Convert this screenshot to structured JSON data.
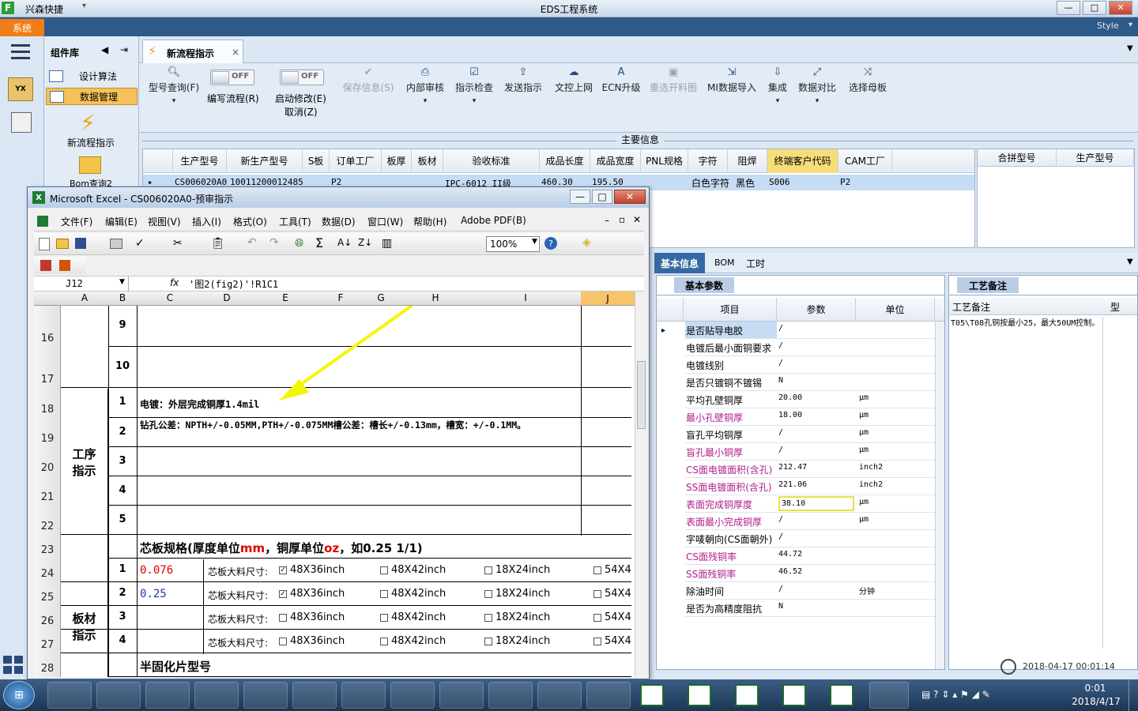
{
  "window": {
    "app_name": "兴森快捷",
    "title": "EDS工程系统",
    "style_label": "Style",
    "controls": [
      "—",
      "□",
      "✕"
    ]
  },
  "system_button": "系统",
  "component_panel": {
    "title": "组件库",
    "items": [
      "设计算法",
      "数据管理"
    ],
    "flow_label": "新流程指示",
    "bom_label": "Bom查询2"
  },
  "tab": {
    "label": "新流程指示",
    "close": "×"
  },
  "ribbon": {
    "model_query": "型号查询(F)",
    "write_flow": "编写流程(R)",
    "start_modify": "启动修改(E)",
    "cancel": "取消(Z)",
    "toggle_off": "OFF",
    "buttons": [
      "保存信息(S)",
      "内部审核",
      "指示检查",
      "发送指示",
      "文控上网",
      "ECN升级",
      "重选开料图",
      "MI数据导入",
      "集成",
      "数据对比",
      "选择母板"
    ]
  },
  "main_info": {
    "title": "主要信息",
    "headers": [
      "生产型号",
      "新生产型号",
      "S板",
      "订单工厂",
      "板厚",
      "板材",
      "验收标准",
      "成品长度",
      "成品宽度",
      "PNL规格",
      "字符",
      "阻焊",
      "终端客户代码",
      "CAM工厂"
    ],
    "row": [
      "CS006020A0",
      "10011200012485",
      "",
      "P2",
      "",
      "",
      "IPC-6012 II级",
      "460.30",
      "195.50",
      "",
      "白色字符",
      "黑色",
      "S006",
      "P2"
    ],
    "side_headers": [
      "合拼型号",
      "生产型号"
    ]
  },
  "excel": {
    "title": "Microsoft Excel - CS006020A0-预审指示",
    "menus": [
      "文件(F)",
      "编辑(E)",
      "视图(V)",
      "插入(I)",
      "格式(O)",
      "工具(T)",
      "数据(D)",
      "窗口(W)",
      "帮助(H)",
      "Adobe PDF(B)"
    ],
    "zoom": "100%",
    "name_box": "J12",
    "formula": "'图2(fig2)'!R1C1",
    "columns": [
      "A",
      "B",
      "C",
      "D",
      "E",
      "F",
      "G",
      "H",
      "I",
      "J"
    ],
    "rows": [
      "16",
      "17",
      "18",
      "19",
      "20",
      "21",
      "22",
      "23",
      "24",
      "25",
      "26",
      "27",
      "28"
    ],
    "b_values": [
      "9",
      "10",
      "1",
      "2",
      "3",
      "4",
      "5",
      "",
      "1",
      "2",
      "3",
      "4",
      ""
    ],
    "section_process": "工序\n指示",
    "section_board": "板材\n指示",
    "line_plating": "电镀：外层完成铜厚1.4mil",
    "line_drill": "钻孔公差：NPTH+/-0.05MM,PTH+/-0.075MM槽公差：槽长+/-0.13mm，槽宽：+/-0.1MM。",
    "core_spec": {
      "prefix": "芯板规格(厚度单位",
      "mm": "mm",
      "mid": "，铜厚单位",
      "oz": "oz",
      "suffix": "，如0.25 1/1)"
    },
    "core_values": [
      "0.076",
      "0.25",
      "",
      ""
    ],
    "size_label": "芯板大料尺寸:",
    "sizes": [
      "48X36inch",
      "48X42inch",
      "18X24inch",
      "54X4"
    ],
    "prepreg_label": "半固化片型号"
  },
  "right_panel": {
    "tabs": [
      "基本信息",
      "BOM",
      "工时"
    ],
    "basic_tab": "基本参数",
    "craft_tab": "工艺备注",
    "headers": [
      "项目",
      "参数",
      "单位"
    ],
    "rows": [
      {
        "name": "是否贴导电胶",
        "value": "/",
        "unit": "",
        "pink": false
      },
      {
        "name": "电镀后最小面铜要求",
        "value": "/",
        "unit": "",
        "pink": false
      },
      {
        "name": "电镀线别",
        "value": "/",
        "unit": "",
        "pink": false
      },
      {
        "name": "是否只镀铜不镀锡",
        "value": "N",
        "unit": "",
        "pink": false
      },
      {
        "name": "平均孔壁铜厚",
        "value": "20.00",
        "unit": "μm",
        "pink": false
      },
      {
        "name": "最小孔壁铜厚",
        "value": "18.00",
        "unit": "μm",
        "pink": true
      },
      {
        "name": "盲孔平均铜厚",
        "value": "/",
        "unit": "μm",
        "pink": false
      },
      {
        "name": "盲孔最小铜厚",
        "value": "/",
        "unit": "μm",
        "pink": true
      },
      {
        "name": "CS面电镀面积(含孔)",
        "value": "212.47",
        "unit": "inch2",
        "pink": true
      },
      {
        "name": "SS面电镀面积(含孔)",
        "value": "221.06",
        "unit": "inch2",
        "pink": true
      },
      {
        "name": "表面完成铜厚度",
        "value": "38.10",
        "unit": "μm",
        "pink": true
      },
      {
        "name": "表面最小完成铜厚",
        "value": "/",
        "unit": "μm",
        "pink": true
      },
      {
        "name": "字唛朝向(CS面朝外)",
        "value": "/",
        "unit": "",
        "pink": false
      },
      {
        "name": "CS面残铜率",
        "value": "44.72",
        "unit": "",
        "pink": true
      },
      {
        "name": "SS面残铜率",
        "value": "46.52",
        "unit": "",
        "pink": true
      },
      {
        "name": "除油时间",
        "value": "/",
        "unit": "分钟",
        "pink": false
      },
      {
        "name": "是否为高精度阻抗",
        "value": "N",
        "unit": "",
        "pink": false
      }
    ],
    "craft_header": "工艺备注",
    "craft_header2": "型",
    "craft_note": "T05\\T08孔铜按最小25，最大50UM控制。",
    "timestamp": "2018-04-17 00:01:14"
  },
  "taskbar": {
    "time": "0:01",
    "date": "2018/4/17"
  }
}
